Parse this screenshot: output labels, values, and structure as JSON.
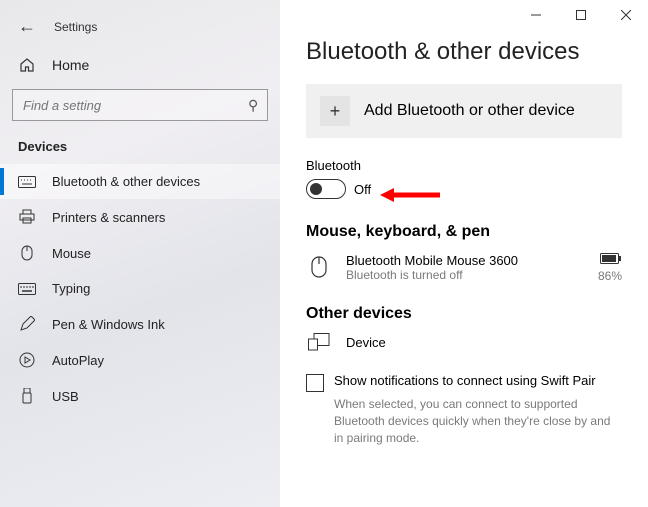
{
  "header": {
    "title": "Settings",
    "home": "Home",
    "search_placeholder": "Find a setting"
  },
  "sidebar": {
    "section": "Devices",
    "items": [
      {
        "label": "Bluetooth & other devices"
      },
      {
        "label": "Printers & scanners"
      },
      {
        "label": "Mouse"
      },
      {
        "label": "Typing"
      },
      {
        "label": "Pen & Windows Ink"
      },
      {
        "label": "AutoPlay"
      },
      {
        "label": "USB"
      }
    ]
  },
  "main": {
    "title": "Bluetooth & other devices",
    "add_device": "Add Bluetooth or other device",
    "bt_label": "Bluetooth",
    "bt_state": "Off",
    "mouse_heading": "Mouse, keyboard, & pen",
    "device1_name": "Bluetooth Mobile Mouse 3600",
    "device1_sub": "Bluetooth is turned off",
    "device1_battery": "86%",
    "other_heading": "Other devices",
    "device2_name": "Device",
    "swift_label": "Show notifications to connect using Swift Pair",
    "swift_desc": "When selected, you can connect to supported Bluetooth devices quickly when they're close by and in pairing mode."
  }
}
